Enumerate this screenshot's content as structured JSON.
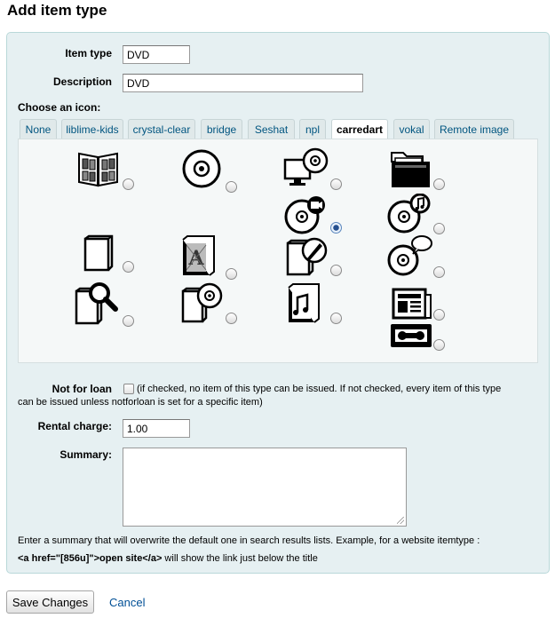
{
  "page": {
    "title": "Add item type"
  },
  "form": {
    "item_type": {
      "label": "Item type",
      "value": "DVD"
    },
    "description": {
      "label": "Description",
      "value": "DVD"
    },
    "choose_icon_label": "Choose an icon:",
    "icon_tabs": [
      {
        "label": "None",
        "active": false
      },
      {
        "label": "liblime-kids",
        "active": false
      },
      {
        "label": "crystal-clear",
        "active": false
      },
      {
        "label": "bridge",
        "active": false
      },
      {
        "label": "Seshat",
        "active": false
      },
      {
        "label": "npl",
        "active": false
      },
      {
        "label": "carredart",
        "active": true
      },
      {
        "label": "vokal",
        "active": false
      },
      {
        "label": "Remote image",
        "active": false
      }
    ],
    "icons": [
      {
        "name": "books-icon",
        "selected": false
      },
      {
        "name": "disc-icon",
        "selected": false
      },
      {
        "name": "computer-disc-icon",
        "selected": false
      },
      {
        "name": "folder-icon",
        "selected": false
      },
      {
        "name": "video-disc-icon",
        "selected": true
      },
      {
        "name": "music-disc-icon",
        "selected": false
      },
      {
        "name": "book-icon",
        "selected": false
      },
      {
        "name": "art-book-icon",
        "selected": false
      },
      {
        "name": "draw-book-icon",
        "selected": false
      },
      {
        "name": "talking-disc-icon",
        "selected": false
      },
      {
        "name": "search-book-icon",
        "selected": false
      },
      {
        "name": "book-disc-icon",
        "selected": false
      },
      {
        "name": "music-book-icon",
        "selected": false
      },
      {
        "name": "newspaper-icon",
        "selected": false
      },
      {
        "name": "videotape-icon",
        "selected": false
      }
    ],
    "not_for_loan": {
      "label": "Not for loan",
      "checked": false,
      "help_line1": "(if checked, no item of this type can be issued. If not checked, every item of this type",
      "help_line2": "can be issued unless notforloan is set for a specific item)"
    },
    "rental_charge": {
      "label": "Rental charge:",
      "value": "1.00"
    },
    "summary": {
      "label": "Summary:",
      "value": "",
      "hint": "Enter a summary that will overwrite the default one in search results lists. Example, for a website itemtype :",
      "example_code": "<a href=\"[856u]\">open site</a>",
      "example_suffix": " will show the link just below the title"
    }
  },
  "actions": {
    "save_label": "Save Changes",
    "cancel_label": "Cancel"
  },
  "colors": {
    "fieldset_bg": "#e6f0f2",
    "fieldset_border": "#b9d8d9",
    "link": "#004f96",
    "radio_selected": "#244f8e"
  }
}
